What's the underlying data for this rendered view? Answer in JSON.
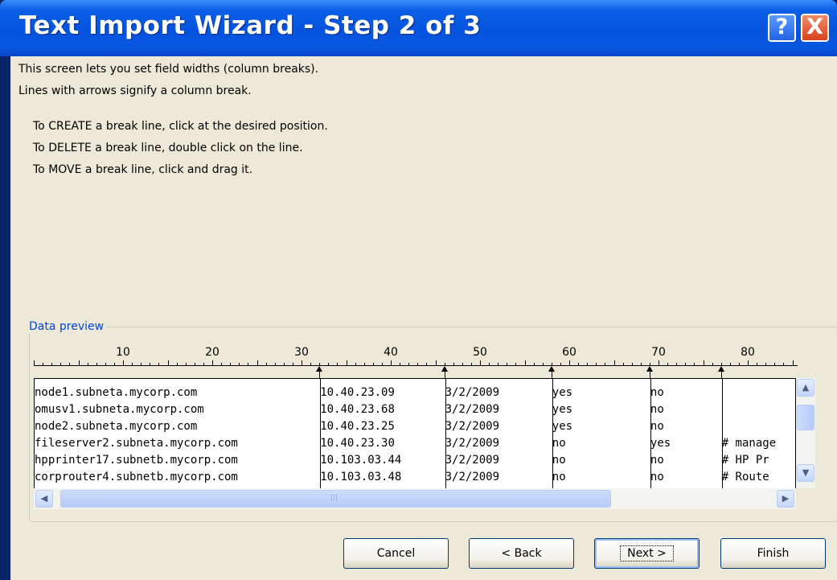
{
  "window": {
    "title": "Text Import Wizard - Step 2 of 3",
    "help_symbol": "?",
    "close_symbol": "X"
  },
  "instructions": {
    "line1": "This screen lets you set field widths (column breaks).",
    "line2": "Lines with arrows signify a column break.",
    "create": "To CREATE a break line, click at the desired position.",
    "delete": "To DELETE a break line, double click on the line.",
    "move": "To MOVE a break line, click and drag it."
  },
  "preview": {
    "group_label": "Data preview",
    "ruler_labels": [
      "10",
      "20",
      "30",
      "40",
      "50",
      "60",
      "70",
      "80"
    ],
    "rows": [
      [
        "node1.subneta.mycorp.com",
        "10.40.23.09",
        "3/2/2009",
        "yes",
        "no",
        ""
      ],
      [
        "omusv1.subneta.mycorp.com",
        "10.40.23.68",
        "3/2/2009",
        "yes",
        "no",
        ""
      ],
      [
        "node2.subneta.mycorp.com",
        "10.40.23.25",
        "3/2/2009",
        "yes",
        "no",
        ""
      ],
      [
        "fileserver2.subneta.mycorp.com",
        "10.40.23.30",
        "3/2/2009",
        "no",
        "yes",
        "# manage"
      ],
      [
        "hpprinter17.subnetb.mycorp.com",
        "10.103.03.44",
        "3/2/2009",
        "no",
        "no",
        "# HP Pr"
      ],
      [
        "corprouter4.subnetb.mycorp.com",
        "10.103.03.48",
        "3/2/2009",
        "no",
        "no",
        "# Route"
      ]
    ],
    "scroll": {
      "up": "▲",
      "down": "▼",
      "left": "◀",
      "right": "▶",
      "grip": "|||"
    }
  },
  "buttons": {
    "cancel": "Cancel",
    "back": "< Back",
    "next": "Next >",
    "finish": "Finish"
  },
  "colors": {
    "titlebar": "#0553de",
    "dialog_bg": "#ece9d8",
    "group_label": "#0046d5",
    "close_button": "#d8421c"
  }
}
